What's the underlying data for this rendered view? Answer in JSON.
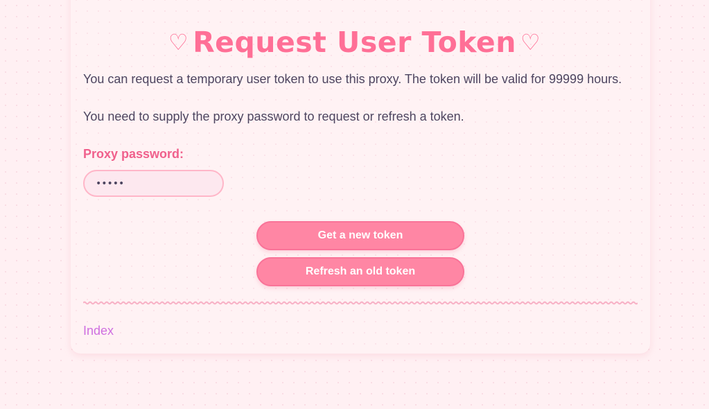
{
  "page": {
    "title": "Request User Token",
    "heart_glyph": "♡"
  },
  "content": {
    "intro": "You can request a temporary user token to use this proxy. The token will be valid for 99999 hours.",
    "note": "You need to supply the proxy password to request or refresh a token."
  },
  "form": {
    "password_label": "Proxy password:",
    "password_value": "•••••"
  },
  "actions": {
    "new_token_label": "Get a new token",
    "refresh_token_label": "Refresh an old token"
  },
  "footer": {
    "index_link": "Index"
  },
  "colors": {
    "accent": "#ff6f96",
    "button": "#ff86a4",
    "link": "#cf6fe0",
    "text": "#4d4560",
    "background": "#fff0f3"
  }
}
